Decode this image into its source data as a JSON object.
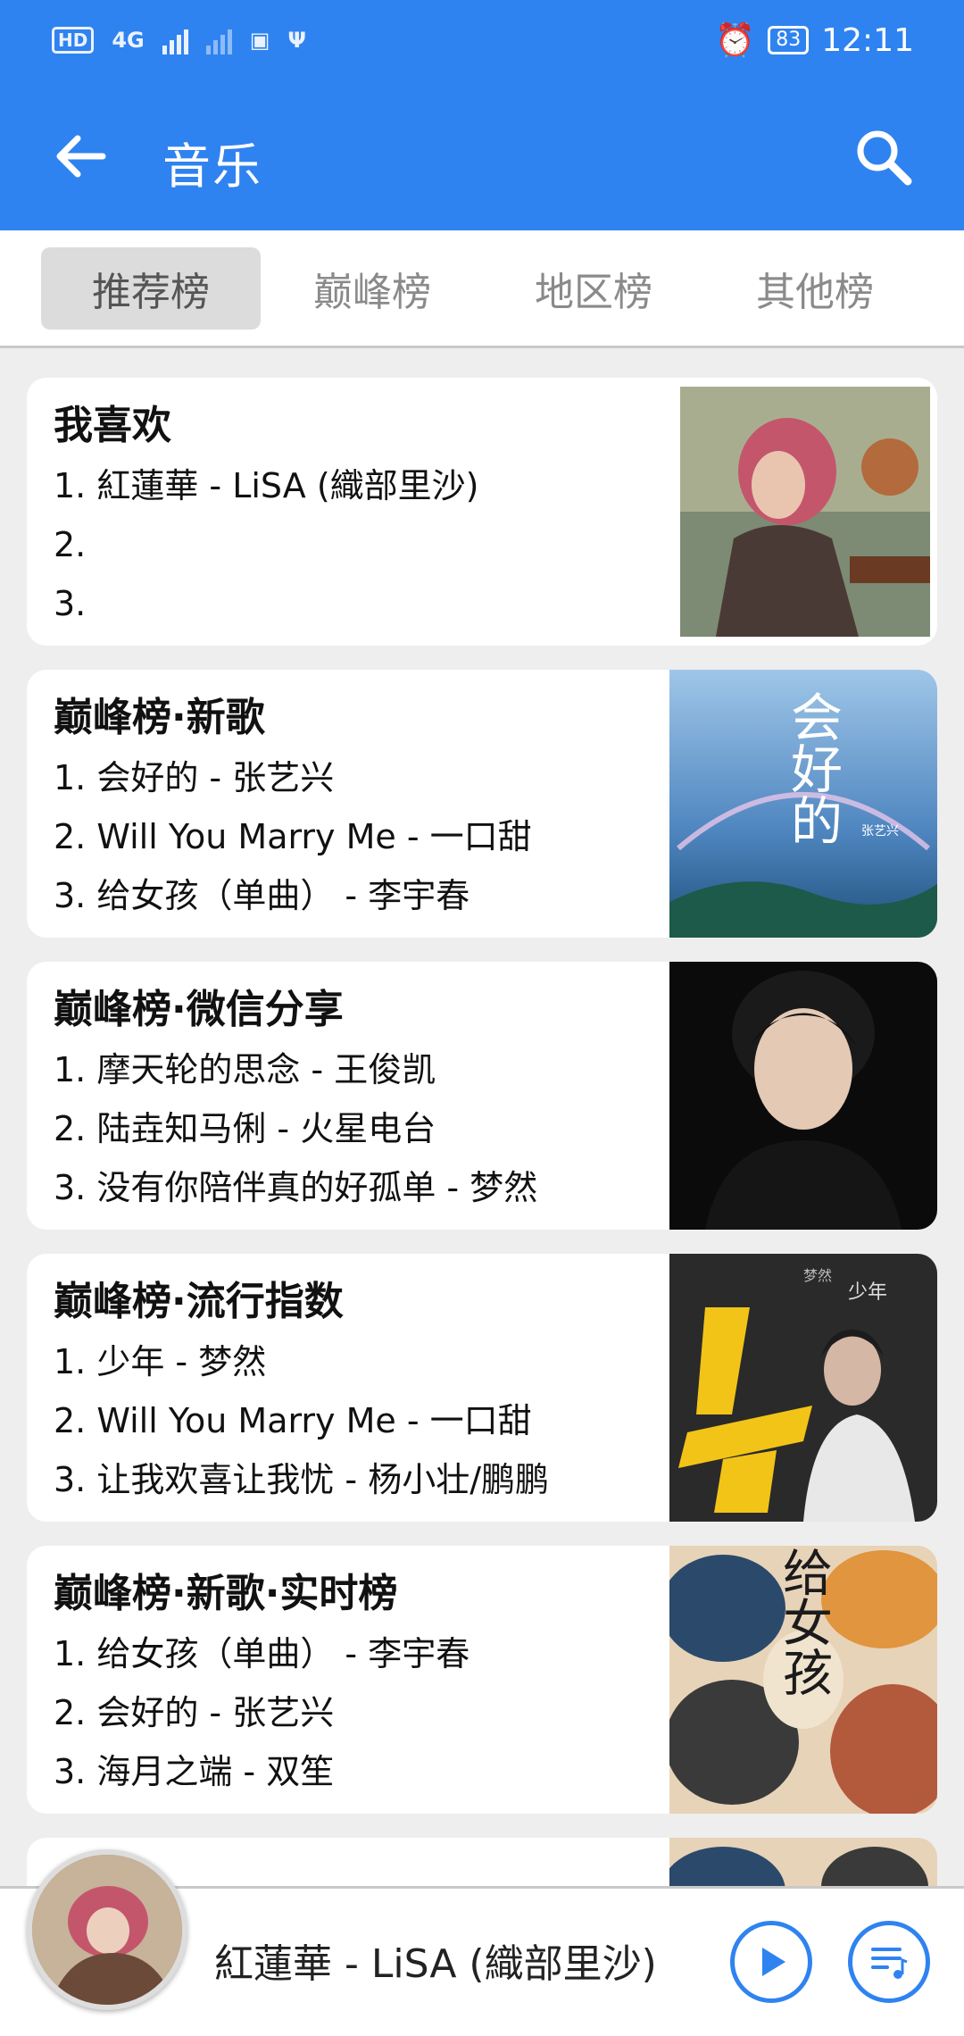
{
  "status_bar": {
    "hd": "HD",
    "sim": "1",
    "net": "4G",
    "battery": "83",
    "time": "12:11"
  },
  "app_bar": {
    "title": "音乐"
  },
  "tabs": [
    {
      "label": "推荐榜",
      "active": true
    },
    {
      "label": "巅峰榜",
      "active": false
    },
    {
      "label": "地区榜",
      "active": false
    },
    {
      "label": "其他榜",
      "active": false
    }
  ],
  "charts": [
    {
      "title": "我喜欢",
      "lines": [
        "1. 紅蓮華 - LiSA (織部里沙)",
        "2.",
        "3."
      ]
    },
    {
      "title": "巅峰榜·新歌",
      "lines": [
        "1. 会好的 - 张艺兴",
        "2. Will You Marry Me - 一口甜",
        "3. 给女孩（单曲） - 李宇春"
      ],
      "cover_text": "会好的",
      "cover_subtext": "张艺兴"
    },
    {
      "title": "巅峰榜·微信分享",
      "lines": [
        "1. 摩天轮的思念 - 王俊凯",
        "2. 陆垚知马俐 - 火星电台",
        "3. 没有你陪伴真的好孤单 - 梦然"
      ]
    },
    {
      "title": "巅峰榜·流行指数",
      "lines": [
        "1. 少年 - 梦然",
        "2. Will You Marry Me - 一口甜",
        "3. 让我欢喜让我忧 - 杨小壮/鹏鹏"
      ],
      "cover_text": "少年",
      "cover_subtext": "梦然"
    },
    {
      "title": "巅峰榜·新歌·实时榜",
      "lines": [
        "1. 给女孩（单曲） - 李宇春",
        "2. 会好的 - 张艺兴",
        "3. 海月之端 - 双笙"
      ],
      "cover_text": "给女孩"
    }
  ],
  "player": {
    "now_playing": "紅蓮華 - LiSA (織部里沙)"
  }
}
